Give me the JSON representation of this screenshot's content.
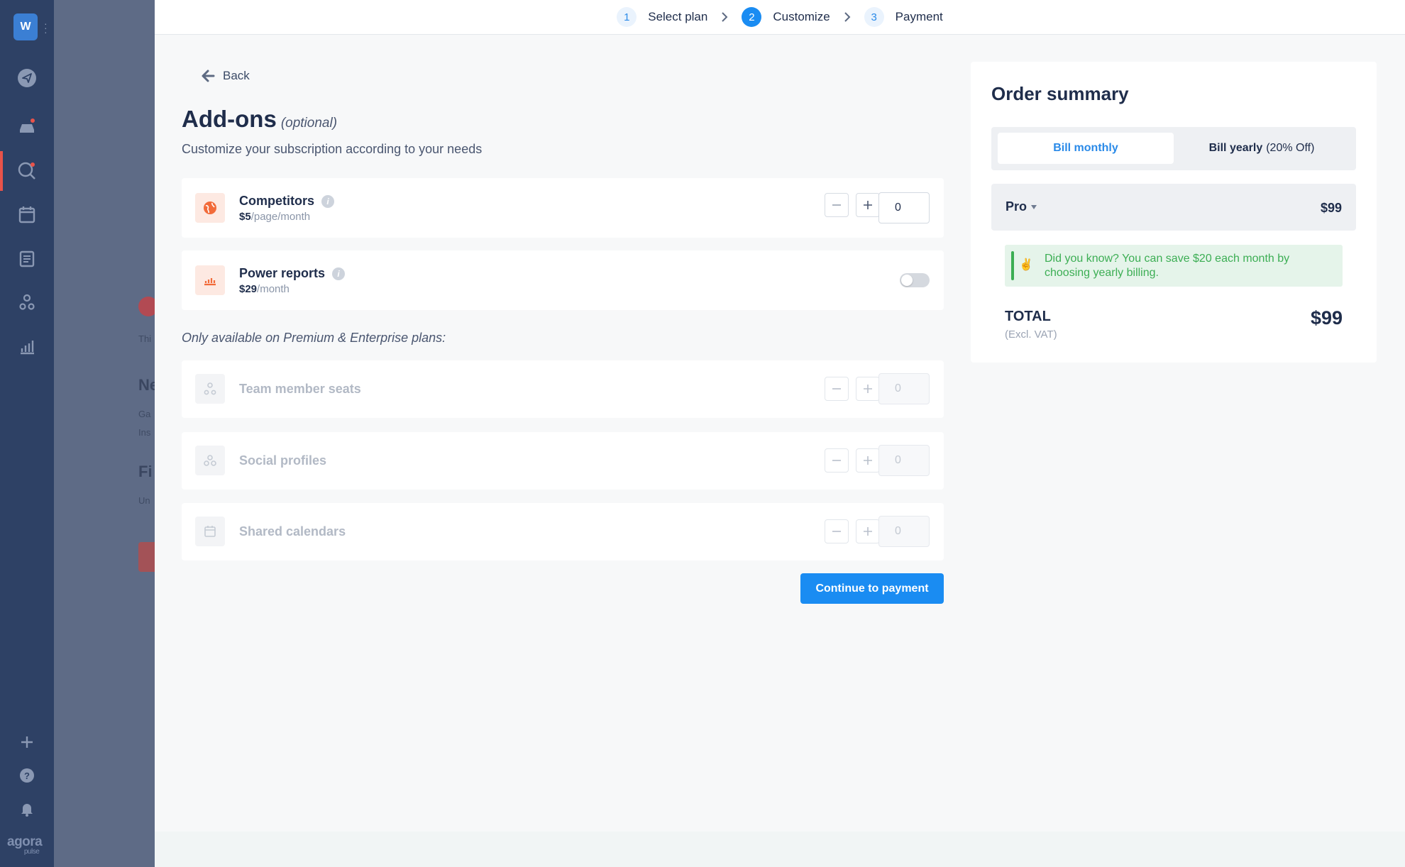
{
  "sidebar": {
    "logo_letter": "W",
    "brand": "agora",
    "brand_sub": "pulse"
  },
  "background": {
    "frag1": "Thi",
    "frag2": "Ne",
    "frag3": "Ga",
    "frag4": "Ins",
    "frag5": "Fi",
    "frag6": "Un"
  },
  "stepper": {
    "steps": [
      {
        "num": "1",
        "label": "Select plan"
      },
      {
        "num": "2",
        "label": "Customize"
      },
      {
        "num": "3",
        "label": "Payment"
      }
    ]
  },
  "back_label": "Back",
  "heading": {
    "title": "Add-ons",
    "optional": "(optional)",
    "subtitle": "Customize your subscription according to your needs"
  },
  "addons": {
    "competitors": {
      "name": "Competitors",
      "price": "$5",
      "unit": "/page/month",
      "qty": "0"
    },
    "power_reports": {
      "name": "Power reports",
      "price": "$29",
      "unit": "/month",
      "enabled": false
    },
    "premium_note": "Only available on Premium & Enterprise plans:",
    "team_seats": {
      "name": "Team member seats",
      "qty": "0"
    },
    "social_profiles": {
      "name": "Social profiles",
      "qty": "0"
    },
    "shared_calendars": {
      "name": "Shared calendars",
      "qty": "0"
    }
  },
  "cta_label": "Continue to payment",
  "summary": {
    "title": "Order summary",
    "bill_monthly": "Bill monthly",
    "bill_yearly": "Bill yearly",
    "bill_yearly_off": "(20% Off)",
    "plan": "Pro",
    "plan_price": "$99",
    "tip": "Did you know? You can save $20 each month by choosing yearly billing.",
    "total_label": "TOTAL",
    "total_sub": "(Excl. VAT)",
    "total_value": "$99"
  },
  "colors": {
    "primary": "#1a8cf2",
    "sidebar": "#2e4165",
    "success": "#3cae54",
    "accent_orange": "#f26b3a"
  }
}
